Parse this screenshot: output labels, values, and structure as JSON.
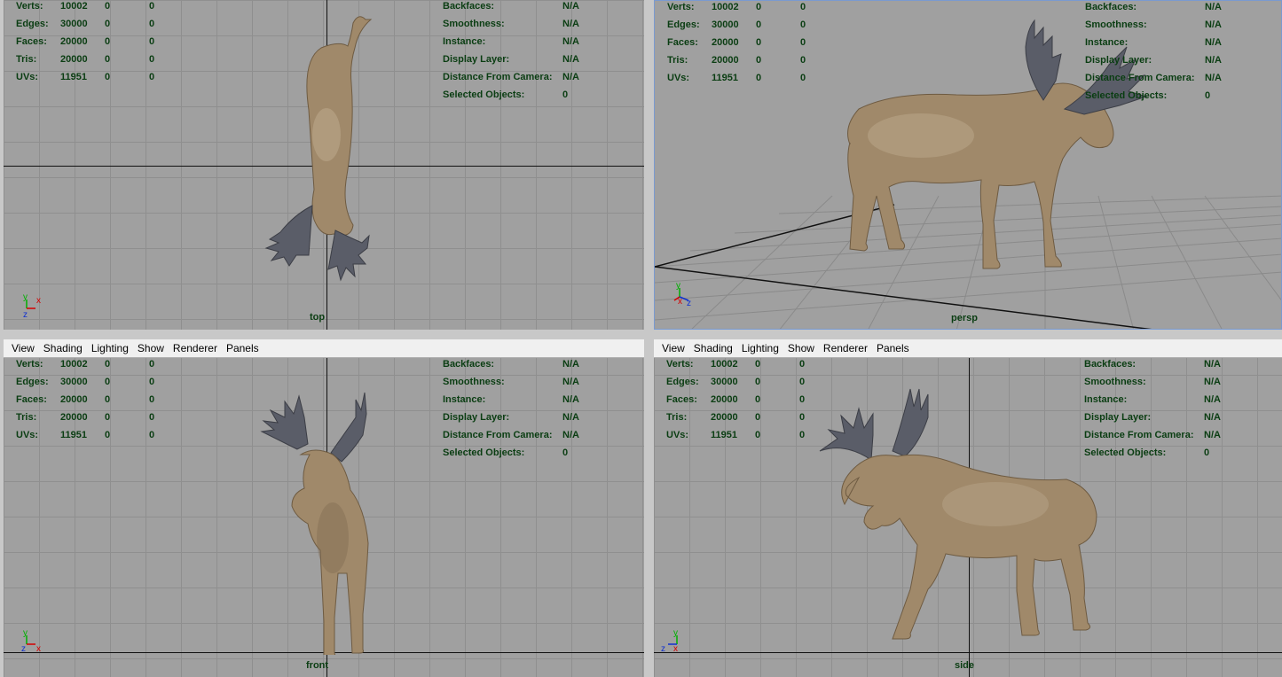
{
  "menu": [
    "View",
    "Shading",
    "Lighting",
    "Show",
    "Renderer",
    "Panels"
  ],
  "hud_left": {
    "rows": [
      {
        "label": "Verts:",
        "a": "10002",
        "b": "0",
        "c": "0"
      },
      {
        "label": "Edges:",
        "a": "30000",
        "b": "0",
        "c": "0"
      },
      {
        "label": "Faces:",
        "a": "20000",
        "b": "0",
        "c": "0"
      },
      {
        "label": "Tris:",
        "a": "20000",
        "b": "0",
        "c": "0"
      },
      {
        "label": "UVs:",
        "a": "11951",
        "b": "0",
        "c": "0"
      }
    ]
  },
  "hud_right": {
    "rows": [
      {
        "label": "Backfaces:",
        "value": "N/A"
      },
      {
        "label": "Smoothness:",
        "value": "N/A"
      },
      {
        "label": "Instance:",
        "value": "N/A"
      },
      {
        "label": "Display Layer:",
        "value": "N/A"
      },
      {
        "label": "Distance From Camera:",
        "value": "N/A"
      },
      {
        "label": "Selected Objects:",
        "value": "0"
      }
    ]
  },
  "viewports": {
    "top": {
      "camera": "top"
    },
    "persp": {
      "camera": "persp"
    },
    "front": {
      "camera": "front"
    },
    "side": {
      "camera": "side"
    }
  },
  "axes": {
    "x": "x",
    "y": "y",
    "z": "z"
  },
  "colors": {
    "viewport_bg": "#a0a0a0",
    "hud_text": "#0a3d12",
    "axis_x": "#d40000",
    "axis_y": "#00b000",
    "axis_z": "#1030d0",
    "antler": "#5a5d68",
    "hide": "#a0896a"
  }
}
